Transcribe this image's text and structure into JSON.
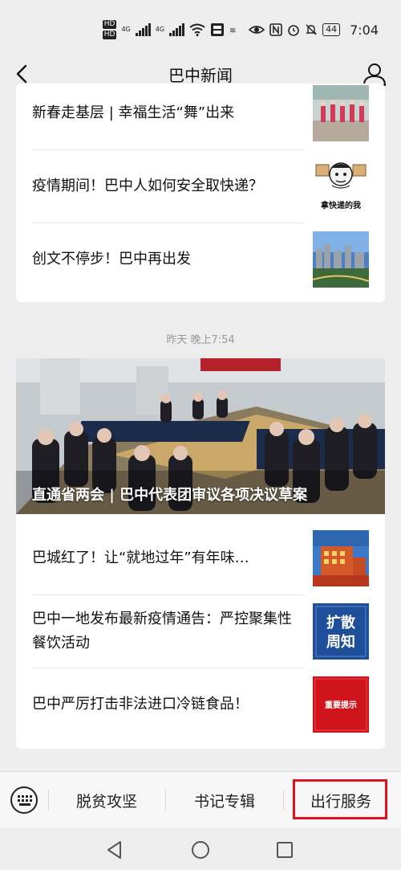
{
  "status_bar": {
    "hd_top": "HD",
    "hd_bottom": "HD",
    "net1": "4G",
    "net2": "4G",
    "battery": "44",
    "time": "7:04"
  },
  "navbar": {
    "title": "巴中新闻"
  },
  "group1": {
    "articles": [
      {
        "title": "新春走基层 | 幸福生活“舞”出来",
        "thumb": "dance-photo"
      },
      {
        "title": "疫情期间！巴中人如何安全取快递？",
        "thumb": "meme-image",
        "thumb_caption": "拿快递的我"
      },
      {
        "title": "创文不停步！巴中再出发",
        "thumb": "city-skyline-photo"
      }
    ]
  },
  "timestamp": "昨天 晚上7:54",
  "group2": {
    "hero_title": "直通省两会 | 巴中代表团审议各项决议草案",
    "articles": [
      {
        "title": "巴城红了！让“就地过年”有年味…",
        "thumb": "night-building-photo"
      },
      {
        "title": "巴中一地发布最新疫情通告：严控聚集性餐饮活动",
        "thumb": "text-badge",
        "thumb_text1": "扩散",
        "thumb_text2": "周知"
      },
      {
        "title": "巴中严厉打击非法进口冷链食品！",
        "thumb": "red-badge",
        "thumb_text": "重要提示"
      }
    ]
  },
  "bottom_menu": {
    "items": [
      "脱贫攻坚",
      "书记专辑",
      "出行服务"
    ]
  },
  "colors": {
    "background": "#ededed",
    "highlight": "#e0141e"
  }
}
